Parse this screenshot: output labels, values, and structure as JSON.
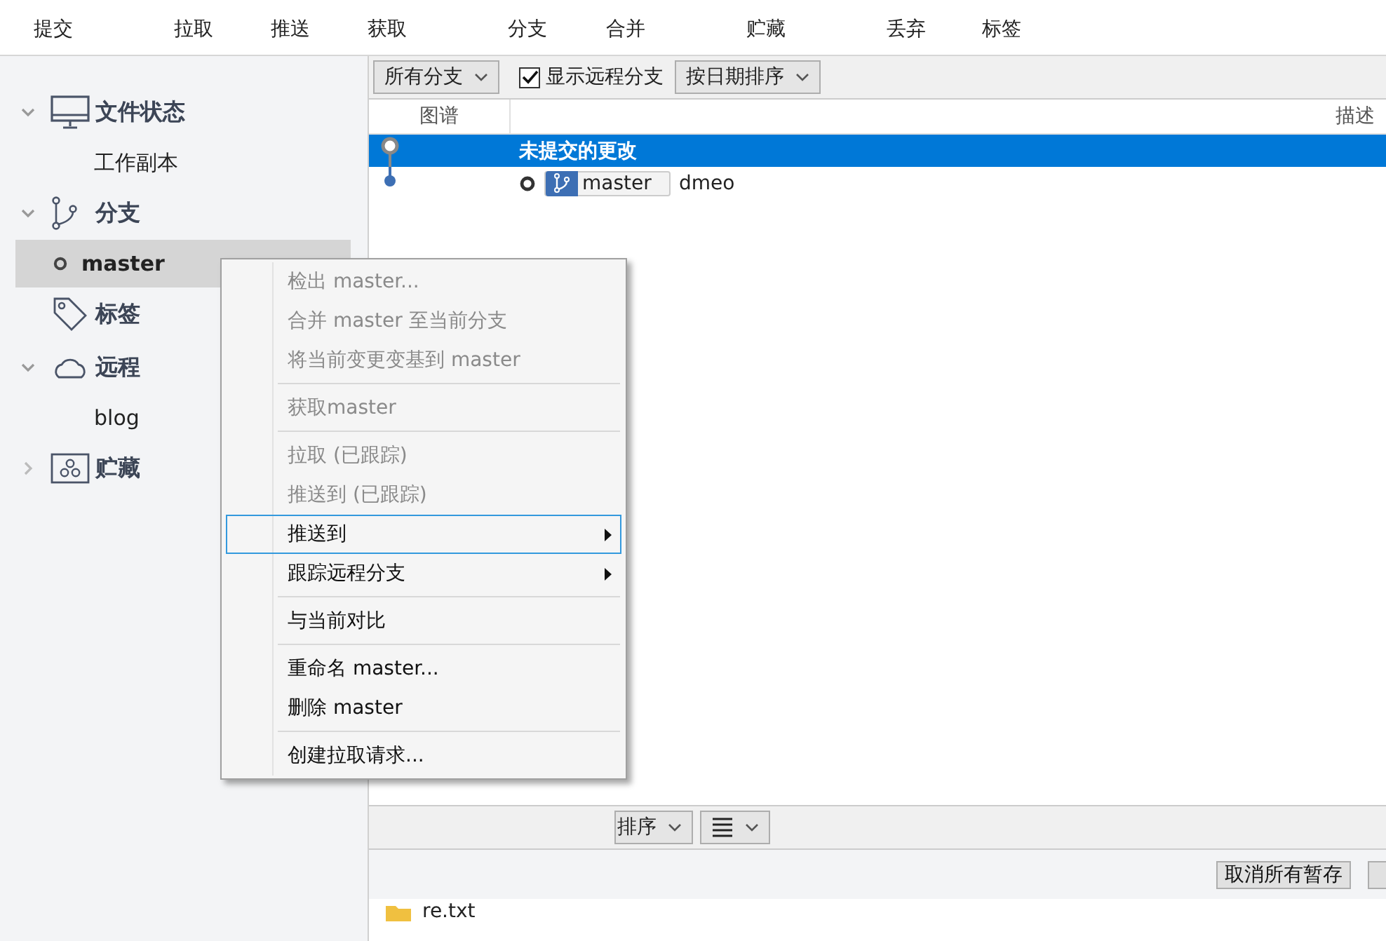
{
  "toolbar": [
    "提交",
    "拉取",
    "推送",
    "获取",
    "分支",
    "合并",
    "贮藏",
    "丢弃",
    "标签"
  ],
  "sidebar": [
    {
      "kind": "file-status",
      "label": "文件状态",
      "expanded": true,
      "children": [
        {
          "label": "工作副本",
          "selected": false,
          "current": false
        }
      ]
    },
    {
      "kind": "branches",
      "label": "分支",
      "expanded": true,
      "children": [
        {
          "label": "master",
          "selected": true,
          "current": true
        }
      ]
    },
    {
      "kind": "tags",
      "label": "标签"
    },
    {
      "kind": "remotes",
      "label": "远程",
      "expanded": true,
      "children": [
        {
          "label": "blog",
          "selected": false,
          "current": false
        }
      ]
    },
    {
      "kind": "stashes",
      "label": "贮藏",
      "expanded": false
    }
  ],
  "graph": {
    "branch_filter": "所有分支",
    "show_remote": {
      "label": "显示远程分支",
      "checked": true
    },
    "sort": "按日期排序",
    "columns": [
      "图谱",
      "描述"
    ],
    "rows": [
      {
        "kind": "uncommitted",
        "description": "未提交的更改",
        "selected": true
      },
      {
        "kind": "commit",
        "branch": "master",
        "description": "dmeo",
        "selected": false
      }
    ]
  },
  "staging": {
    "sort": "排序",
    "button": "取消所有暂存",
    "files": [
      {
        "name": "re.txt"
      }
    ]
  },
  "context_menu": [
    {
      "kind": "item",
      "label": "检出 master...",
      "disabled": true,
      "selected": false
    },
    {
      "kind": "item",
      "label": "合并 master 至当前分支",
      "disabled": true,
      "selected": false
    },
    {
      "kind": "item",
      "label": "将当前变更变基到 master",
      "disabled": true,
      "selected": false
    },
    {
      "kind": "separator"
    },
    {
      "kind": "item",
      "label": "获取master",
      "disabled": true,
      "selected": false
    },
    {
      "kind": "separator"
    },
    {
      "kind": "item",
      "label": "拉取 (已跟踪)",
      "disabled": true,
      "selected": false
    },
    {
      "kind": "item",
      "label": "推送到 (已跟踪)",
      "disabled": true,
      "selected": false
    },
    {
      "kind": "item",
      "label": "推送到",
      "disabled": false,
      "selected": true,
      "submenu": true
    },
    {
      "kind": "item",
      "label": "跟踪远程分支",
      "disabled": false,
      "selected": false,
      "submenu": true
    },
    {
      "kind": "separator"
    },
    {
      "kind": "item",
      "label": "与当前对比",
      "disabled": false,
      "selected": false
    },
    {
      "kind": "separator"
    },
    {
      "kind": "item",
      "label": "重命名 master...",
      "disabled": false,
      "selected": false
    },
    {
      "kind": "item",
      "label": "删除 master",
      "disabled": false,
      "selected": false
    },
    {
      "kind": "separator"
    },
    {
      "kind": "item",
      "label": "创建拉取请求...",
      "disabled": false,
      "selected": false
    }
  ]
}
